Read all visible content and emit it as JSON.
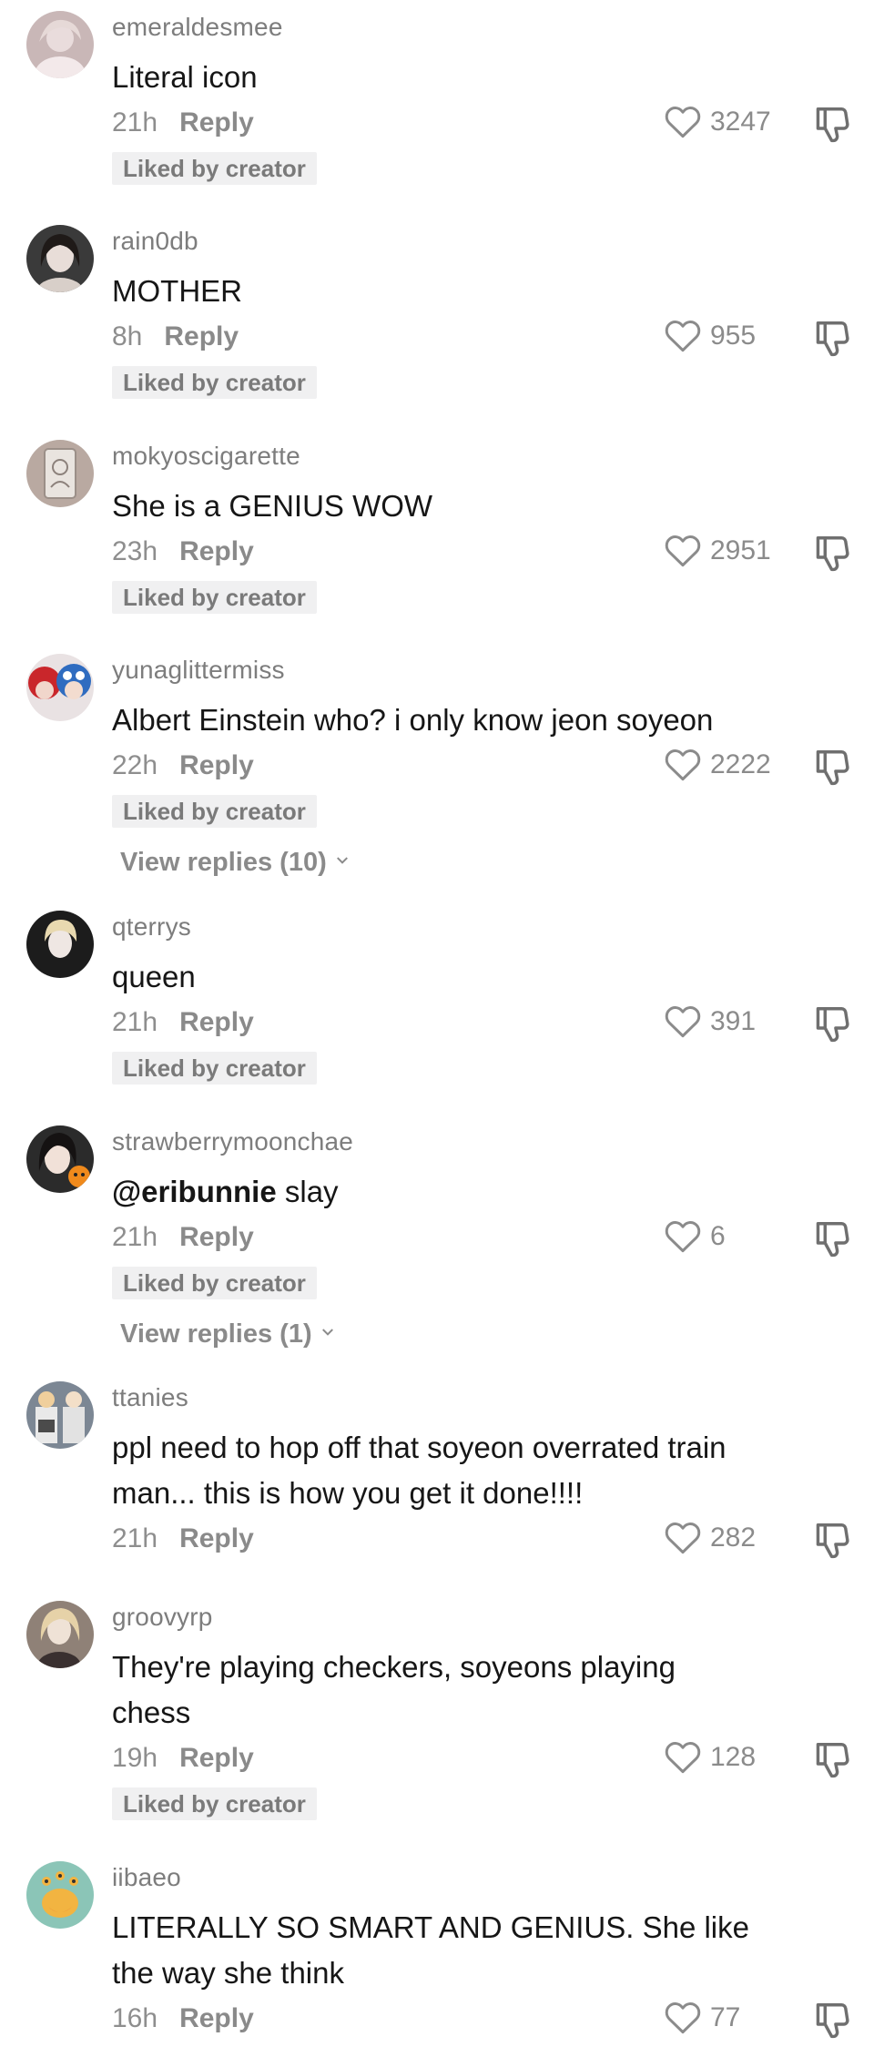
{
  "comments": [
    {
      "username": "emeraldesmee",
      "text": "Literal icon",
      "time": "21h",
      "reply_label": "Reply",
      "likes": "3247",
      "liked_by_creator": "Liked by creator",
      "avatar_icon": "avatar-photo",
      "avatar_color": "#c9b7b7"
    },
    {
      "username": "rain0db",
      "text": "MOTHER",
      "time": "8h",
      "reply_label": "Reply",
      "likes": "955",
      "liked_by_creator": "Liked by creator",
      "avatar_icon": "avatar-photo",
      "avatar_color": "#3a3a3a"
    },
    {
      "username": "mokyoscigarette",
      "text": "She is a GENIUS WOW",
      "time": "23h",
      "reply_label": "Reply",
      "likes": "2951",
      "liked_by_creator": "Liked by creator",
      "avatar_icon": "avatar-photo",
      "avatar_color": "#b9a9a1"
    },
    {
      "username": "yunaglittermiss",
      "text": "Albert Einstein who? i only know jeon soyeon",
      "time": "22h",
      "reply_label": "Reply",
      "likes": "2222",
      "liked_by_creator": "Liked by creator",
      "view_replies": "View replies (10)",
      "avatar_icon": "avatar-photo",
      "avatar_color": "#3f6fb3"
    },
    {
      "username": "qterrys",
      "text": "queen",
      "time": "21h",
      "reply_label": "Reply",
      "likes": "391",
      "liked_by_creator": "Liked by creator",
      "avatar_icon": "avatar-photo",
      "avatar_color": "#1c1c1c"
    },
    {
      "username": "strawberrymoonchae",
      "mention": "@eribunnie",
      "text": " slay",
      "time": "21h",
      "reply_label": "Reply",
      "likes": "6",
      "liked_by_creator": "Liked by creator",
      "view_replies": "View replies (1)",
      "avatar_icon": "avatar-photo",
      "avatar_color": "#2b2b2b"
    },
    {
      "username": "ttanies",
      "text": "ppl need to hop off that soyeon overrated train man... this is how you get it done!!!!",
      "time": "21h",
      "reply_label": "Reply",
      "likes": "282",
      "avatar_icon": "avatar-photo",
      "avatar_color": "#7c8794"
    },
    {
      "username": "groovyrp",
      "text": "They're playing checkers, soyeons playing chess",
      "time": "19h",
      "reply_label": "Reply",
      "likes": "128",
      "liked_by_creator": "Liked by creator",
      "avatar_icon": "avatar-photo",
      "avatar_color": "#8f8177"
    },
    {
      "username": "iibaeo",
      "text": "LITERALLY SO SMART AND GENIUS. She like the way she think",
      "time": "16h",
      "reply_label": "Reply",
      "likes": "77",
      "avatar_icon": "avatar-cartoon",
      "avatar_color": "#8bc5b7"
    }
  ],
  "colors": {
    "username": "#7d7d7d",
    "text": "#161616",
    "meta": "#8e8e8e",
    "badge_bg": "#f0f0f1",
    "icon": "#8b8b8b"
  }
}
